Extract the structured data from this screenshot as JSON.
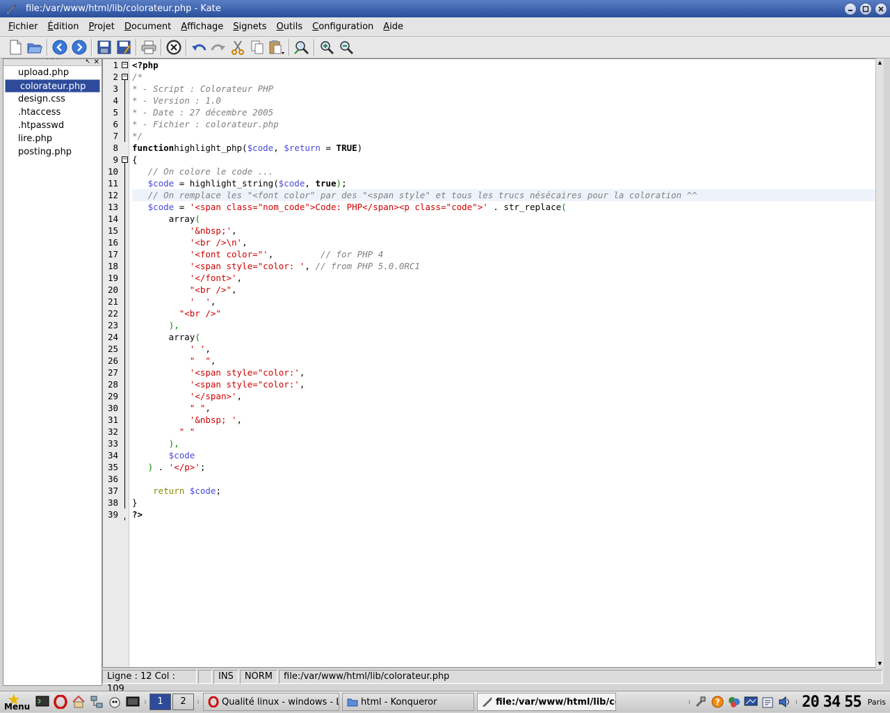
{
  "window": {
    "title": "file:/var/www/html/lib/colorateur.php - Kate"
  },
  "menu": [
    {
      "u": "F",
      "rest": "ichier"
    },
    {
      "u": "É",
      "rest": "dition"
    },
    {
      "u": "P",
      "rest": "rojet"
    },
    {
      "u": "D",
      "rest": "ocument"
    },
    {
      "u": "A",
      "rest": "ffichage"
    },
    {
      "u": "S",
      "rest": "ignets"
    },
    {
      "u": "O",
      "rest": "utils"
    },
    {
      "u": "C",
      "rest": "onfiguration"
    },
    {
      "u": "A",
      "rest": "ide"
    }
  ],
  "toolbar": [
    "new-document-icon",
    "open-folder-icon",
    "back-icon",
    "forward-icon",
    "save-icon",
    "save-as-icon",
    "print-icon",
    "close-document-icon",
    "undo-icon",
    "redo-icon",
    "cut-icon",
    "copy-icon",
    "paste-icon",
    "find-icon",
    "zoom-in-icon",
    "zoom-out-icon"
  ],
  "files": [
    "upload.php",
    "colorateur.php",
    "design.css",
    ".htaccess",
    ".htpasswd",
    "lire.php",
    "posting.php"
  ],
  "selected_file": 1,
  "sidebar_header": "ˆ ˆ ˆ",
  "code_lines": [
    [
      [
        "k",
        "<?php"
      ]
    ],
    [
      [
        "c",
        "/*"
      ]
    ],
    [
      [
        "c",
        "* - Script : Colorateur PHP"
      ]
    ],
    [
      [
        "c",
        "* - Version : 1.0"
      ]
    ],
    [
      [
        "c",
        "* - Date : 27 décembre 2005"
      ]
    ],
    [
      [
        "c",
        "* - Fichier : colorateur.php"
      ]
    ],
    [
      [
        "c",
        "*/"
      ]
    ],
    [
      [
        "k",
        "function"
      ],
      [
        "",
        "highlight_php("
      ],
      [
        "v",
        "$code"
      ],
      [
        "",
        ", "
      ],
      [
        "v",
        "$return"
      ],
      [
        "",
        " = "
      ],
      [
        "k",
        "TRUE"
      ],
      [
        "",
        ")"
      ]
    ],
    [
      [
        "",
        "{"
      ]
    ],
    [
      [
        "",
        "   "
      ],
      [
        "c",
        "// On colore le code ..."
      ]
    ],
    [
      [
        "",
        "   "
      ],
      [
        "v",
        "$code"
      ],
      [
        "",
        " = highlight_string("
      ],
      [
        "v",
        "$code"
      ],
      [
        "",
        ", "
      ],
      [
        "k",
        "true"
      ],
      [
        "g",
        ")"
      ],
      [
        "",
        ";"
      ]
    ],
    [
      [
        "",
        "   "
      ],
      [
        "c",
        "// On remplace les \"<font color\" par des \"<span style\" et tous les trucs nésécaires pour la coloration ^^"
      ]
    ],
    [
      [
        "",
        "   "
      ],
      [
        "v",
        "$code"
      ],
      [
        "",
        " = "
      ],
      [
        "s",
        "'<span class=\"nom_code\">Code: PHP</span><p class=\"code\">'"
      ],
      [
        "",
        " . str_replace"
      ],
      [
        "g",
        "("
      ]
    ],
    [
      [
        "",
        "       array"
      ],
      [
        "g",
        "("
      ]
    ],
    [
      [
        "",
        "           "
      ],
      [
        "s",
        "'&nbsp;'"
      ],
      [
        "",
        ","
      ]
    ],
    [
      [
        "",
        "           "
      ],
      [
        "s",
        "'<br />\\n'"
      ],
      [
        "",
        ","
      ]
    ],
    [
      [
        "",
        "           "
      ],
      [
        "s",
        "'<font color=\"'"
      ],
      [
        "",
        ",         "
      ],
      [
        "c",
        "// for PHP 4"
      ]
    ],
    [
      [
        "",
        "           "
      ],
      [
        "s",
        "'<span style=\"color: '"
      ],
      [
        "",
        ", "
      ],
      [
        "c",
        "// from PHP 5.0.0RC1"
      ]
    ],
    [
      [
        "",
        "           "
      ],
      [
        "s",
        "'</font>'"
      ],
      [
        "",
        ","
      ]
    ],
    [
      [
        "",
        "           "
      ],
      [
        "s",
        "\"<br />\""
      ],
      [
        "",
        ","
      ]
    ],
    [
      [
        "",
        "           "
      ],
      [
        "s",
        "'  '"
      ],
      [
        "",
        ","
      ]
    ],
    [
      [
        "",
        "         "
      ],
      [
        "s",
        "\"<br />\""
      ]
    ],
    [
      [
        "",
        "       "
      ],
      [
        "g",
        "),"
      ]
    ],
    [
      [
        "",
        "       array"
      ],
      [
        "g",
        "("
      ]
    ],
    [
      [
        "",
        "           "
      ],
      [
        "s",
        "' '"
      ],
      [
        "",
        ","
      ]
    ],
    [
      [
        "",
        "           "
      ],
      [
        "s",
        "\"  \""
      ],
      [
        "",
        ","
      ]
    ],
    [
      [
        "",
        "           "
      ],
      [
        "s",
        "'<span style=\"color:'"
      ],
      [
        "",
        ","
      ]
    ],
    [
      [
        "",
        "           "
      ],
      [
        "s",
        "'<span style=\"color:'"
      ],
      [
        "",
        ","
      ]
    ],
    [
      [
        "",
        "           "
      ],
      [
        "s",
        "'</span>'"
      ],
      [
        "",
        ","
      ]
    ],
    [
      [
        "",
        "           "
      ],
      [
        "s",
        "\" \""
      ],
      [
        "",
        ","
      ]
    ],
    [
      [
        "",
        "           "
      ],
      [
        "s",
        "'&nbsp; '"
      ],
      [
        "",
        ","
      ]
    ],
    [
      [
        "",
        "         "
      ],
      [
        "s",
        "\" \""
      ]
    ],
    [
      [
        "",
        "       "
      ],
      [
        "g",
        "),"
      ]
    ],
    [
      [
        "",
        "       "
      ],
      [
        "v",
        "$code"
      ]
    ],
    [
      [
        "",
        "   "
      ],
      [
        "g",
        ")"
      ],
      [
        "",
        " . "
      ],
      [
        "s",
        "'</p>'"
      ],
      [
        "",
        ";"
      ]
    ],
    [
      [
        "",
        ""
      ]
    ],
    [
      [
        "",
        "    "
      ],
      [
        "r",
        "return"
      ],
      [
        "",
        " "
      ],
      [
        "v",
        "$code"
      ],
      [
        "",
        ";"
      ]
    ],
    [
      [
        "",
        "}"
      ]
    ],
    [
      [
        "k",
        "?>"
      ]
    ]
  ],
  "highlight_line": 12,
  "status": {
    "position": "Ligne : 12 Col : 109",
    "modified": "",
    "mode_ins": "INS",
    "mode_norm": "NORM",
    "path": "file:/var/www/html/lib/colorateur.php"
  },
  "taskbar": {
    "menu_label": "Menu",
    "desktops": [
      "1",
      "2"
    ],
    "active_desktop": 0,
    "tasks": [
      {
        "label": "Qualité linux - windows - Le",
        "icon": "opera-icon"
      },
      {
        "label": "html - Konqueror",
        "icon": "folder-icon"
      },
      {
        "label": "file:/var/www/html/lib/co",
        "icon": "kate-icon"
      }
    ],
    "active_task": 2,
    "clock": {
      "h": "20",
      "m": "34",
      "s": "55"
    },
    "city": "Paris"
  },
  "colors": {
    "titlebar": "#2a4f9c",
    "selection": "#2d4b9a",
    "keyword": "#000000",
    "variable": "#4848d8",
    "string": "#cc0000",
    "comment": "#808080"
  }
}
